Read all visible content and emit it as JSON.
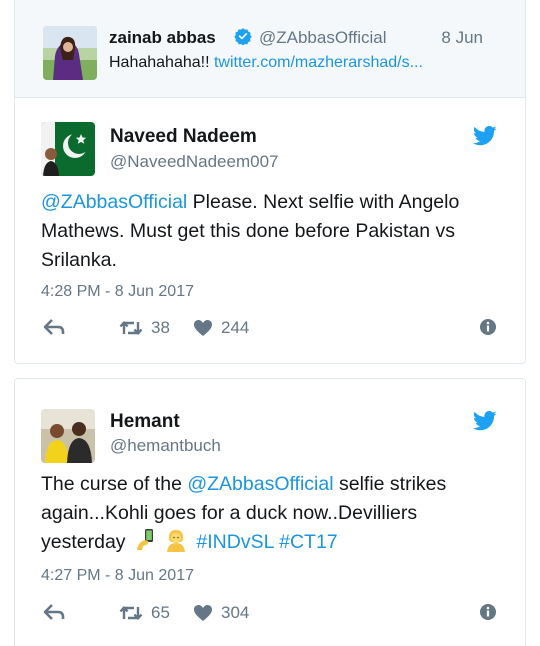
{
  "quoted_tweet": {
    "display_name": "zainab abbas",
    "handle": "@ZAbbasOfficial",
    "date": "8 Jun",
    "text": "Hahahahaha!! ",
    "link": "twitter.com/mazherarshad/s..."
  },
  "tweets": [
    {
      "display_name": "Naveed Nadeem",
      "handle": "@NaveedNadeem007",
      "mention": "@ZAbbasOfficial",
      "text_lines": [
        " Please. Next selfie with Angelo",
        "Mathews. Must get this done before Pakistan vs",
        "Srilanka."
      ],
      "timestamp": "4:28 PM - 8 Jun 2017",
      "retweets": "38",
      "likes": "244"
    },
    {
      "display_name": "Hemant",
      "handle": "@hemantbuch",
      "text_before": "The curse of the ",
      "mention": "@ZAbbasOfficial",
      "text_after": " selfie strikes",
      "text_line2": "again...Kohli goes for a duck now..Devilliers",
      "text_line3": "yesterday",
      "hashtags": [
        "#INDvSL",
        "#CT17"
      ],
      "timestamp": "4:27 PM - 8 Jun 2017",
      "retweets": "65",
      "likes": "304"
    }
  ],
  "colors": {
    "link": "#1b95e0",
    "muted": "#657786",
    "text": "#14171a",
    "border": "#e1e8ed",
    "quoted_bg": "#f5f8fa"
  },
  "icons": [
    "verified-badge-icon",
    "twitter-bird-icon",
    "reply-icon",
    "retweet-icon",
    "heart-icon",
    "info-icon",
    "selfie-emoji-icon",
    "person-emoji-icon"
  ]
}
